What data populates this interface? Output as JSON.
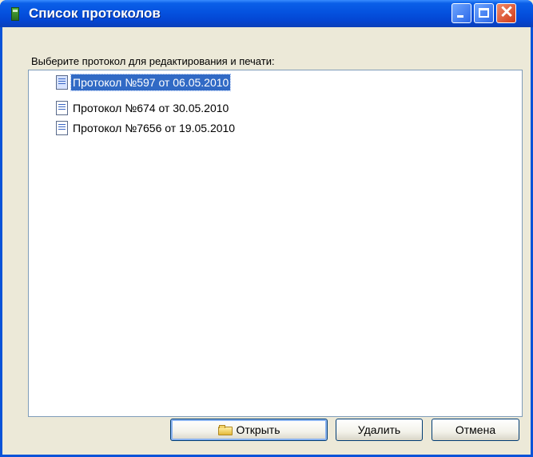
{
  "window": {
    "title": "Список протоколов",
    "title_bar_color": "#0552df",
    "controls": [
      "minimize-icon",
      "maximize-icon",
      "close-icon"
    ],
    "close_glyph": "✕"
  },
  "prompt": "Выберите протокол для редактирования и печати:",
  "protocols": [
    {
      "label": "Протокол №597 от 06.05.2010",
      "selected": true,
      "icon": "document-icon"
    },
    {
      "label": "Протокол №674 от 30.05.2010",
      "selected": false,
      "icon": "document-icon"
    },
    {
      "label": "Протокол №7656 от 19.05.2010",
      "selected": false,
      "icon": "document-icon"
    }
  ],
  "selection_color": "#316ac5",
  "buttons": {
    "open": {
      "label": "Открыть",
      "icon": "folder-icon"
    },
    "delete": {
      "label": "Удалить"
    },
    "cancel": {
      "label": "Отмена"
    }
  }
}
